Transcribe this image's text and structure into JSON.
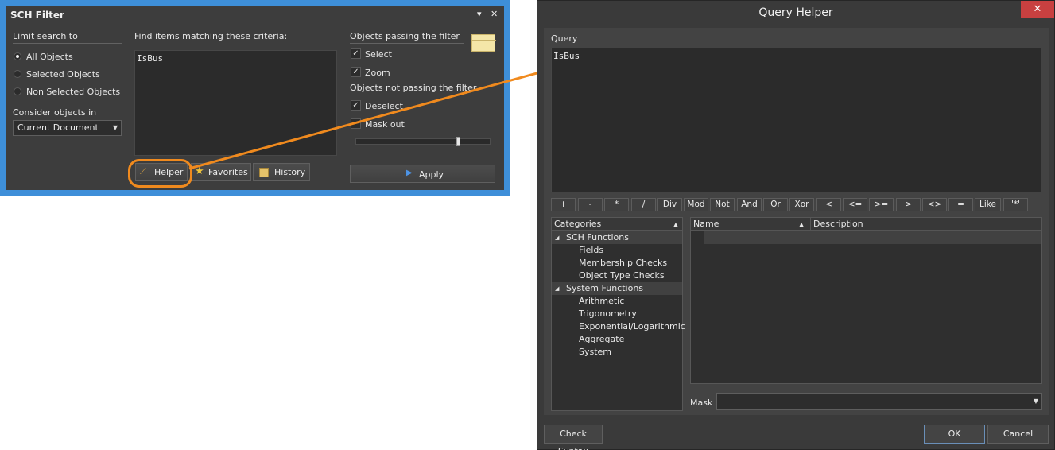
{
  "sch_filter": {
    "title": "SCH Filter",
    "menu_glyph": "▾",
    "close_glyph": "✕",
    "limit_label": "Limit search to",
    "radios": [
      {
        "label": "All Objects",
        "selected": true
      },
      {
        "label": "Selected Objects",
        "selected": false
      },
      {
        "label": "Non Selected Objects",
        "selected": false
      }
    ],
    "consider_label": "Consider objects in",
    "consider_value": "Current Document",
    "criteria_label": "Find items matching these criteria:",
    "query_text": "IsBus",
    "passing_label": "Objects passing the filter",
    "passing_options": [
      {
        "label": "Select",
        "checked": true
      },
      {
        "label": "Zoom",
        "checked": true
      }
    ],
    "not_passing_label": "Objects not passing the filter",
    "not_passing_options": [
      {
        "label": "Deselect",
        "checked": true
      },
      {
        "label": "Mask out",
        "checked": false
      }
    ],
    "slider_level": 0.77,
    "buttons": {
      "helper": "Helper",
      "favorites": "Favorites",
      "history": "History",
      "apply": "Apply"
    }
  },
  "query_helper": {
    "title": "Query Helper",
    "close_glyph": "✕",
    "query_label": "Query",
    "query_text": "IsBus",
    "operators": [
      "+",
      "-",
      "*",
      "/",
      "Div",
      "Mod",
      "Not",
      "And",
      "Or",
      "Xor",
      "<",
      "<=",
      ">=",
      ">",
      "<>",
      "=",
      "Like",
      "'*'"
    ],
    "categories_header": "Categories",
    "categories": [
      {
        "label": "SCH Functions",
        "group": true,
        "expander": "◢"
      },
      {
        "label": "Fields",
        "group": false
      },
      {
        "label": "Membership Checks",
        "group": false
      },
      {
        "label": "Object Type Checks",
        "group": false
      },
      {
        "label": "System Functions",
        "group": true,
        "expander": "◢"
      },
      {
        "label": "Arithmetic",
        "group": false
      },
      {
        "label": "Trigonometry",
        "group": false
      },
      {
        "label": "Exponential/Logarithmic",
        "group": false
      },
      {
        "label": "Aggregate",
        "group": false
      },
      {
        "label": "System",
        "group": false
      }
    ],
    "name_header": "Name",
    "description_header": "Description",
    "mask_label": "Mask",
    "mask_value": "",
    "buttons": {
      "check_syntax": "Check Syntax",
      "ok": "OK",
      "cancel": "Cancel"
    }
  },
  "colors": {
    "accent_border": "#3e8fd9",
    "highlight": "#f08a1e",
    "close_red": "#c84040"
  }
}
